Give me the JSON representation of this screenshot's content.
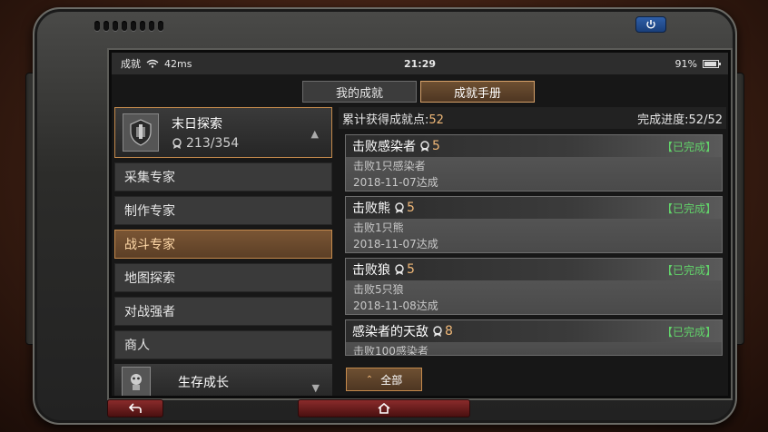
{
  "status_bar": {
    "carrier": "成就",
    "ping": "42ms",
    "time": "21:29",
    "battery": "91%",
    "battery_level": 0.91
  },
  "tabs": [
    {
      "label": "我的成就",
      "active": false
    },
    {
      "label": "成就手册",
      "active": true
    }
  ],
  "category": {
    "title": "末日探索",
    "count": "213/354"
  },
  "menu": [
    {
      "label": "采集专家",
      "active": false
    },
    {
      "label": "制作专家",
      "active": false
    },
    {
      "label": "战斗专家",
      "active": true
    },
    {
      "label": "地图探索",
      "active": false
    },
    {
      "label": "对战强者",
      "active": false
    },
    {
      "label": "商人",
      "active": false
    }
  ],
  "category_footer": {
    "title": "生存成长"
  },
  "summary": {
    "points_label": "累计获得成就点:",
    "points_value": "52",
    "progress_label": "完成进度:",
    "progress_value": "52/52"
  },
  "achievements": [
    {
      "title": "击败感染者",
      "points": "5",
      "status": "【已完成】",
      "desc": "击败1只感染者",
      "date": "2018-11-07达成"
    },
    {
      "title": "击败熊",
      "points": "5",
      "status": "【已完成】",
      "desc": "击败1只熊",
      "date": "2018-11-07达成"
    },
    {
      "title": "击败狼",
      "points": "5",
      "status": "【已完成】",
      "desc": "击败5只狼",
      "date": "2018-11-08达成"
    },
    {
      "title": "感染者的天敌",
      "points": "8",
      "status": "【已完成】",
      "desc": "击败100感染者",
      "date": ""
    }
  ],
  "filter": {
    "label": "全部"
  },
  "colors": {
    "accent": "#c48a4c",
    "points": "#f0b878",
    "complete": "#62d36a",
    "power": "#2f5fa8",
    "nav_red": "#8a2b2b"
  }
}
